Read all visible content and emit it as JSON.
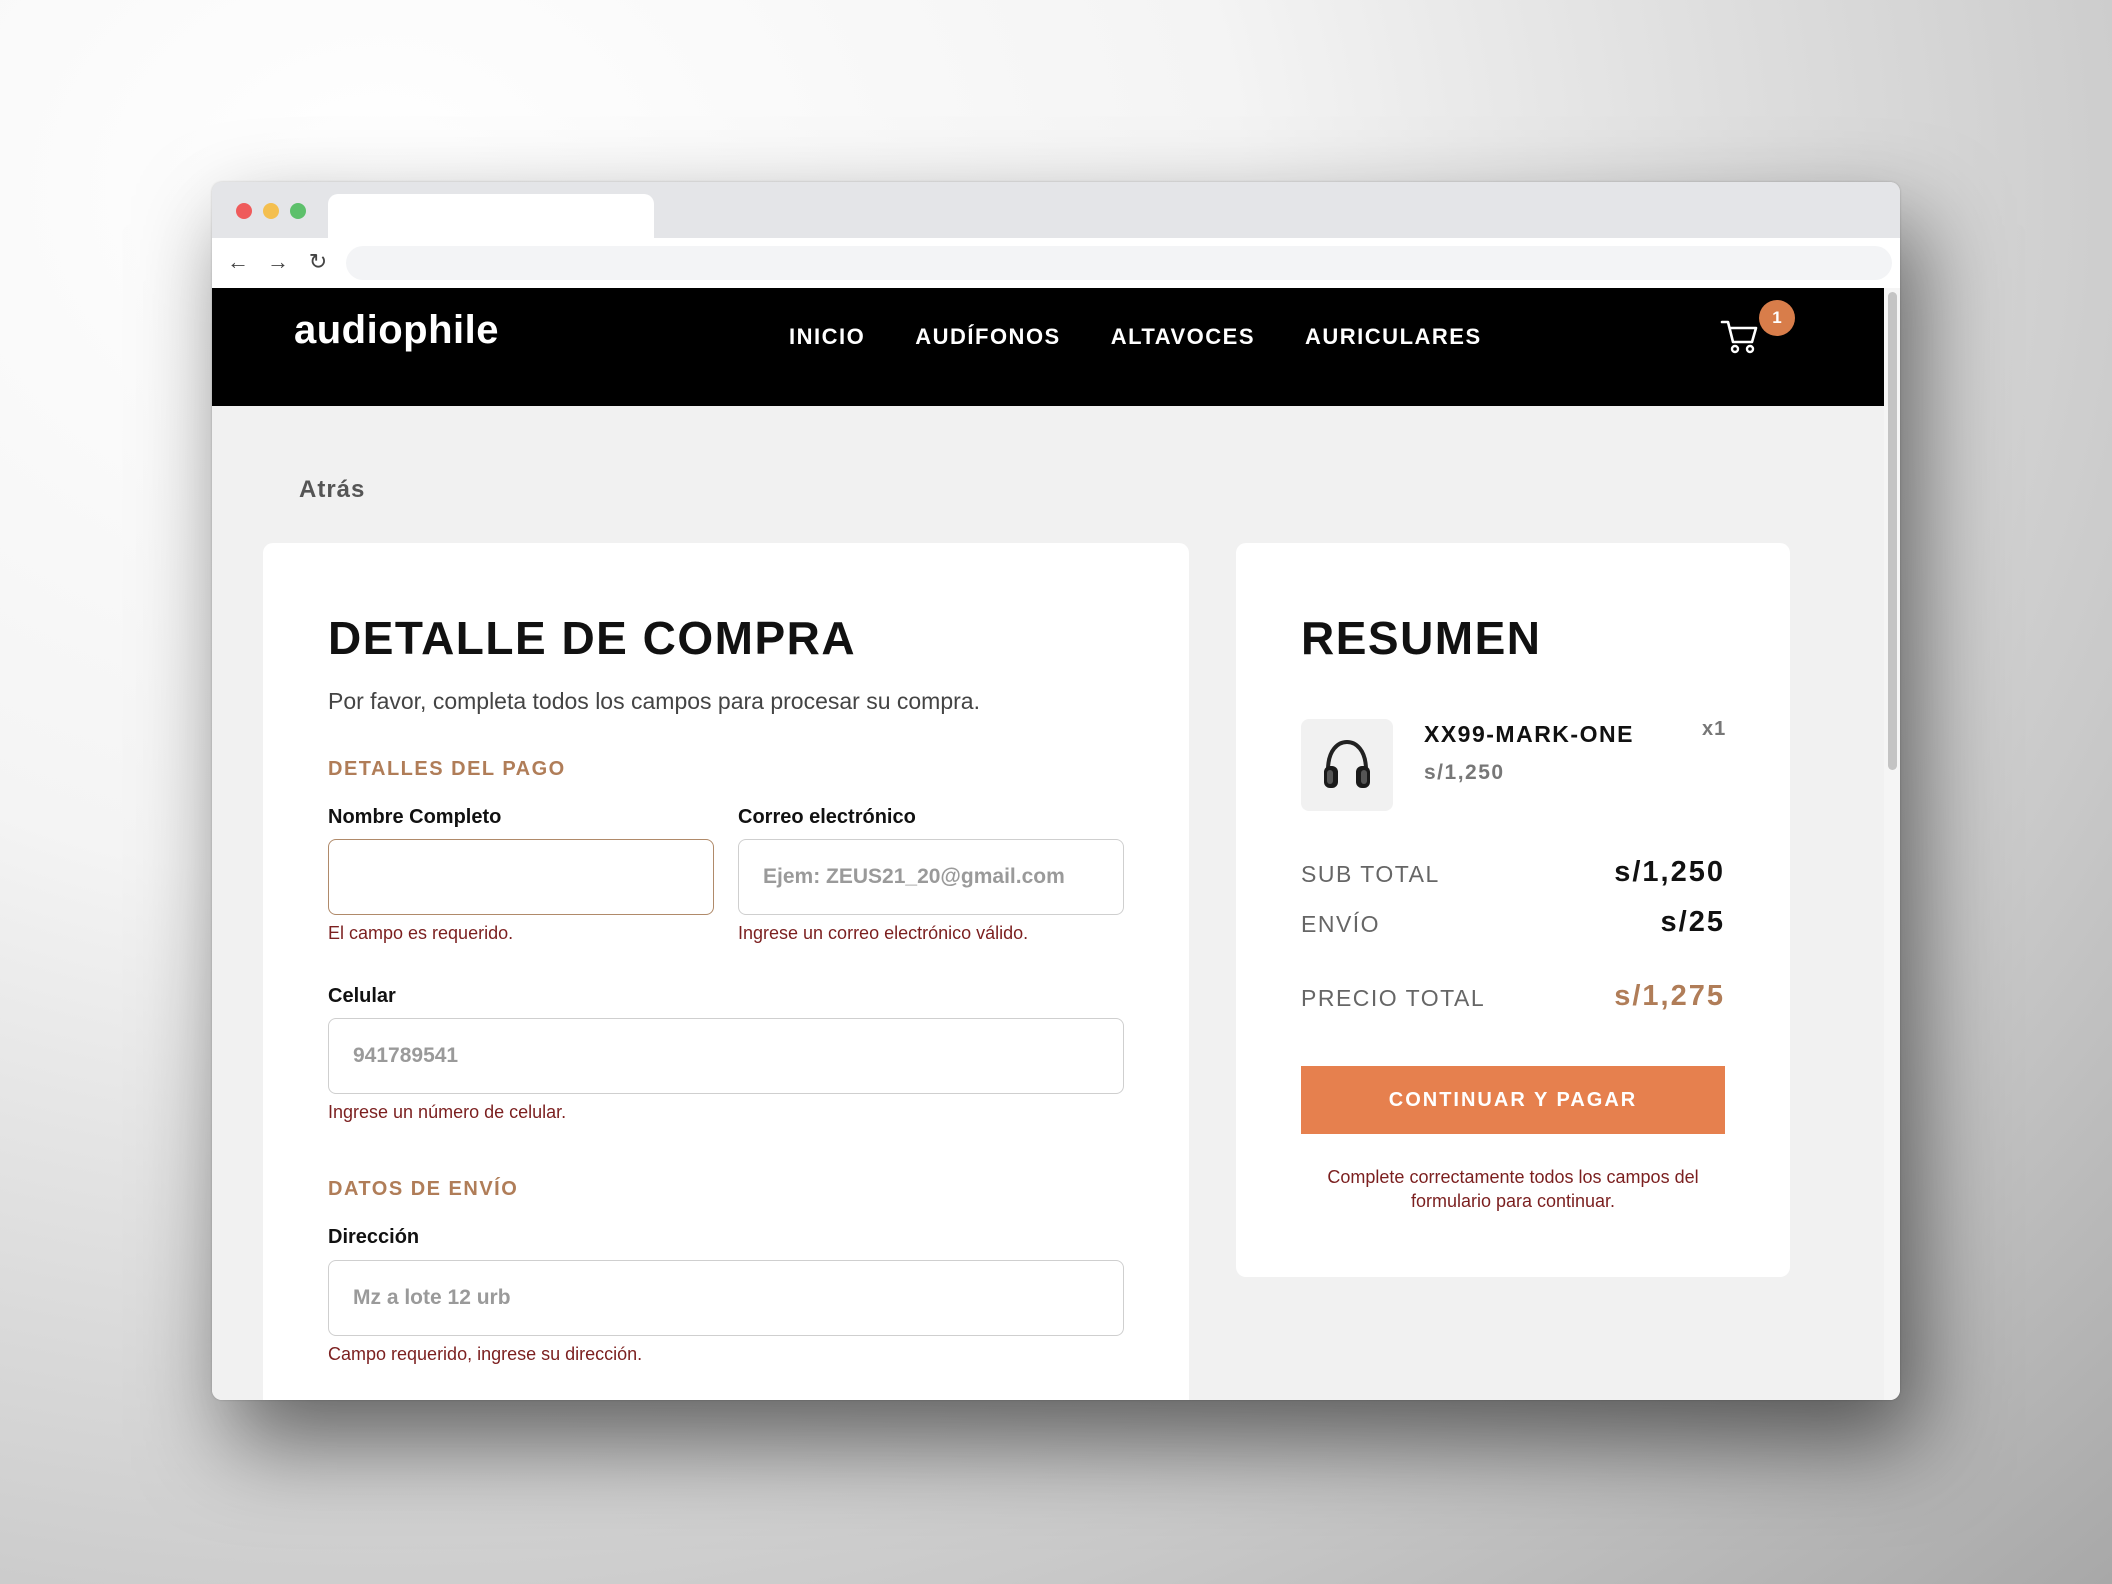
{
  "brand": {
    "logo": "audiophile",
    "accent": "#d87d4a"
  },
  "nav": {
    "items": [
      "INICIO",
      "AUDÍFONOS",
      "ALTAVOCES",
      "AURICULARES"
    ]
  },
  "cart": {
    "count": "1"
  },
  "back": "Atrás",
  "form": {
    "title": "DETALLE DE COMPRA",
    "intro": "Por favor, completa todos los campos para procesar su compra.",
    "payment_section": "DETALLES DEL PAGO",
    "name_label": "Nombre Completo",
    "name_value": "",
    "name_error": "El campo es requerido.",
    "email_label": "Correo electrónico",
    "email_placeholder": "Ejem: ZEUS21_20@gmail.com",
    "email_error": "Ingrese un correo electrónico válido.",
    "phone_label": "Celular",
    "phone_placeholder": "941789541",
    "phone_error": "Ingrese un número de celular.",
    "shipping_section": "DATOS DE ENVÍO",
    "address_label": "Dirección",
    "address_placeholder": "Mz a lote 12 urb",
    "address_error": "Campo requerido, ingrese su dirección."
  },
  "summary": {
    "title": "RESUMEN",
    "product": {
      "name": "XX99-MARK-ONE",
      "price": "s/1,250",
      "qty": "x1",
      "icon": "headphones-icon"
    },
    "subtotal_label": "SUB TOTAL",
    "subtotal_value": "s/1,250",
    "shipping_label": "ENVÍO",
    "shipping_value": "s/25",
    "total_label": "PRECIO TOTAL",
    "total_value": "s/1,275",
    "pay_button": "CONTINUAR Y PAGAR",
    "note": "Complete correctamente todos los campos del formulario para continuar."
  }
}
